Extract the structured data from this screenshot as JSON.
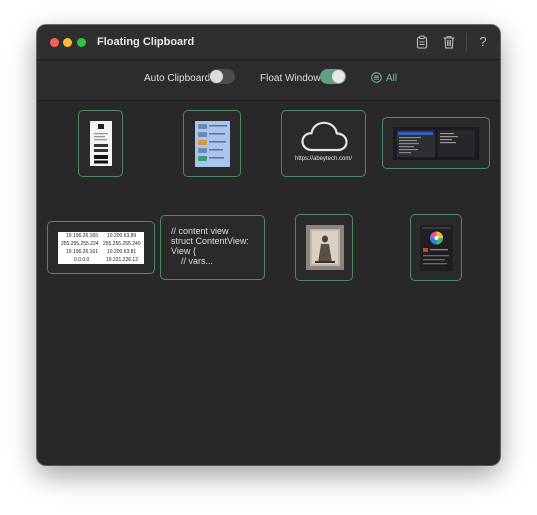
{
  "window": {
    "title": "Floating Clipboard"
  },
  "titlebar": {
    "icons": [
      "clipboard-icon",
      "trash-icon"
    ],
    "help_label": "?"
  },
  "toolbar": {
    "auto_clipboard_label": "Auto Clipboard",
    "auto_clipboard_on": false,
    "float_window_label": "Float Window",
    "float_window_on": true,
    "filter_label": "All",
    "filter_icon": "filter-list-icon"
  },
  "colors": {
    "window_bg": "#282828",
    "accent": "#5e9e83",
    "card_border": "#4a8a6b"
  },
  "clips": {
    "ip_table": [
      [
        "10.196.26.165",
        "10.200.63.89"
      ],
      [
        "255.255.255.224",
        "255.255.255.240"
      ],
      [
        "10.196.26.161",
        "10.200.63.81"
      ],
      [
        "0.0.0.0",
        "10.221.226.12"
      ]
    ],
    "code_text": "// content view\nstruct ContentView:\nView {\n    // vars...",
    "url_text": "https://abeytech.com/"
  }
}
